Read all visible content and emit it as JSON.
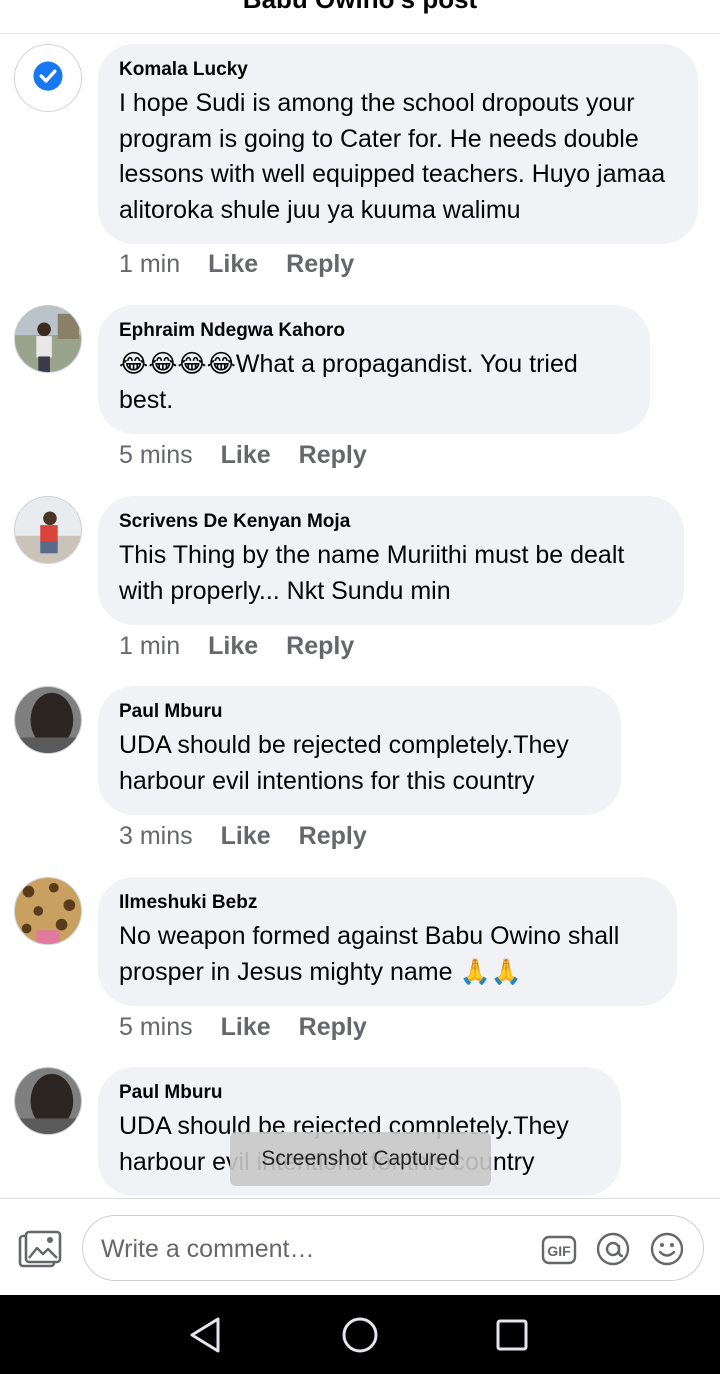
{
  "header": {
    "title": "Babu Owino's post"
  },
  "comments": [
    {
      "author": "Komala Lucky",
      "text": "I hope Sudi is among the school dropouts your program is going to Cater for. He needs double lessons with well equipped teachers. Huyo jamaa alitoroka shule juu ya kuuma walimu",
      "time": "1 min",
      "like": "Like",
      "reply": "Reply",
      "avatar": "check-badge-icon"
    },
    {
      "author": "Ephraim Ndegwa Kahoro",
      "emoji": "😂😂😂😂",
      "text": "What a propagandist. You tried best.",
      "time": "5 mins",
      "like": "Like",
      "reply": "Reply"
    },
    {
      "author": "Scrivens De Kenyan Moja",
      "text": "This Thing by the name Muriithi must be dealt with properly... Nkt Sundu min",
      "time": "1 min",
      "like": "Like",
      "reply": "Reply"
    },
    {
      "author": "Paul Mburu",
      "text": "UDA should be rejected completely.They harbour evil intentions for this country",
      "time": "3 mins",
      "like": "Like",
      "reply": "Reply"
    },
    {
      "author": "Ilmeshuki Bebz",
      "text": "No weapon formed against Babu Owino shall prosper in Jesus mighty name",
      "emoji": "🙏🙏",
      "time": "5 mins",
      "like": "Like",
      "reply": "Reply"
    },
    {
      "author": "Paul Mburu",
      "text": "UDA should be rejected completely.They harbour evil intentions for this country"
    }
  ],
  "toast": "Screenshot Captured",
  "composer": {
    "placeholder": "Write a comment…",
    "gif_label": "GIF"
  },
  "colors": {
    "bubble": "#f0f2f5",
    "meta": "#65676b",
    "accent": "#1877f2",
    "navbar": "#000000"
  },
  "icons": [
    "photo-icon",
    "gif-icon",
    "mention-icon",
    "emoji-icon",
    "back-icon",
    "home-icon",
    "recents-icon"
  ]
}
